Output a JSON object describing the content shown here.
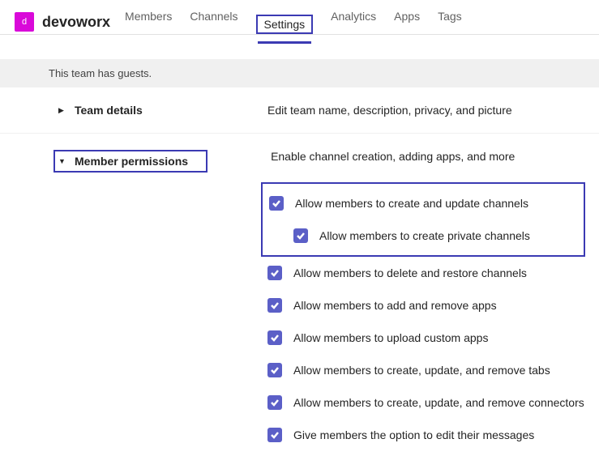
{
  "team": {
    "icon_letter": "d",
    "name": "devoworx"
  },
  "tabs": [
    {
      "label": "Members"
    },
    {
      "label": "Channels"
    },
    {
      "label": "Settings"
    },
    {
      "label": "Analytics"
    },
    {
      "label": "Apps"
    },
    {
      "label": "Tags"
    }
  ],
  "banner": "This team has guests.",
  "sections": {
    "team_details": {
      "title": "Team details",
      "desc": "Edit team name, description, privacy, and picture"
    },
    "member_permissions": {
      "title": "Member permissions",
      "desc": "Enable channel creation, adding apps, and more"
    }
  },
  "permissions": [
    {
      "label": "Allow members to create and update channels",
      "checked": true
    },
    {
      "label": "Allow members to create private channels",
      "checked": true
    },
    {
      "label": "Allow members to delete and restore channels",
      "checked": true
    },
    {
      "label": "Allow members to add and remove apps",
      "checked": true
    },
    {
      "label": "Allow members to upload custom apps",
      "checked": true
    },
    {
      "label": "Allow members to create, update, and remove tabs",
      "checked": true
    },
    {
      "label": "Allow members to create, update, and remove connectors",
      "checked": true
    },
    {
      "label": "Give members the option to edit their messages",
      "checked": true
    }
  ],
  "colors": {
    "accent": "#5b5fc7",
    "highlight": "#3b3ab3",
    "brand": "#d909d9"
  }
}
